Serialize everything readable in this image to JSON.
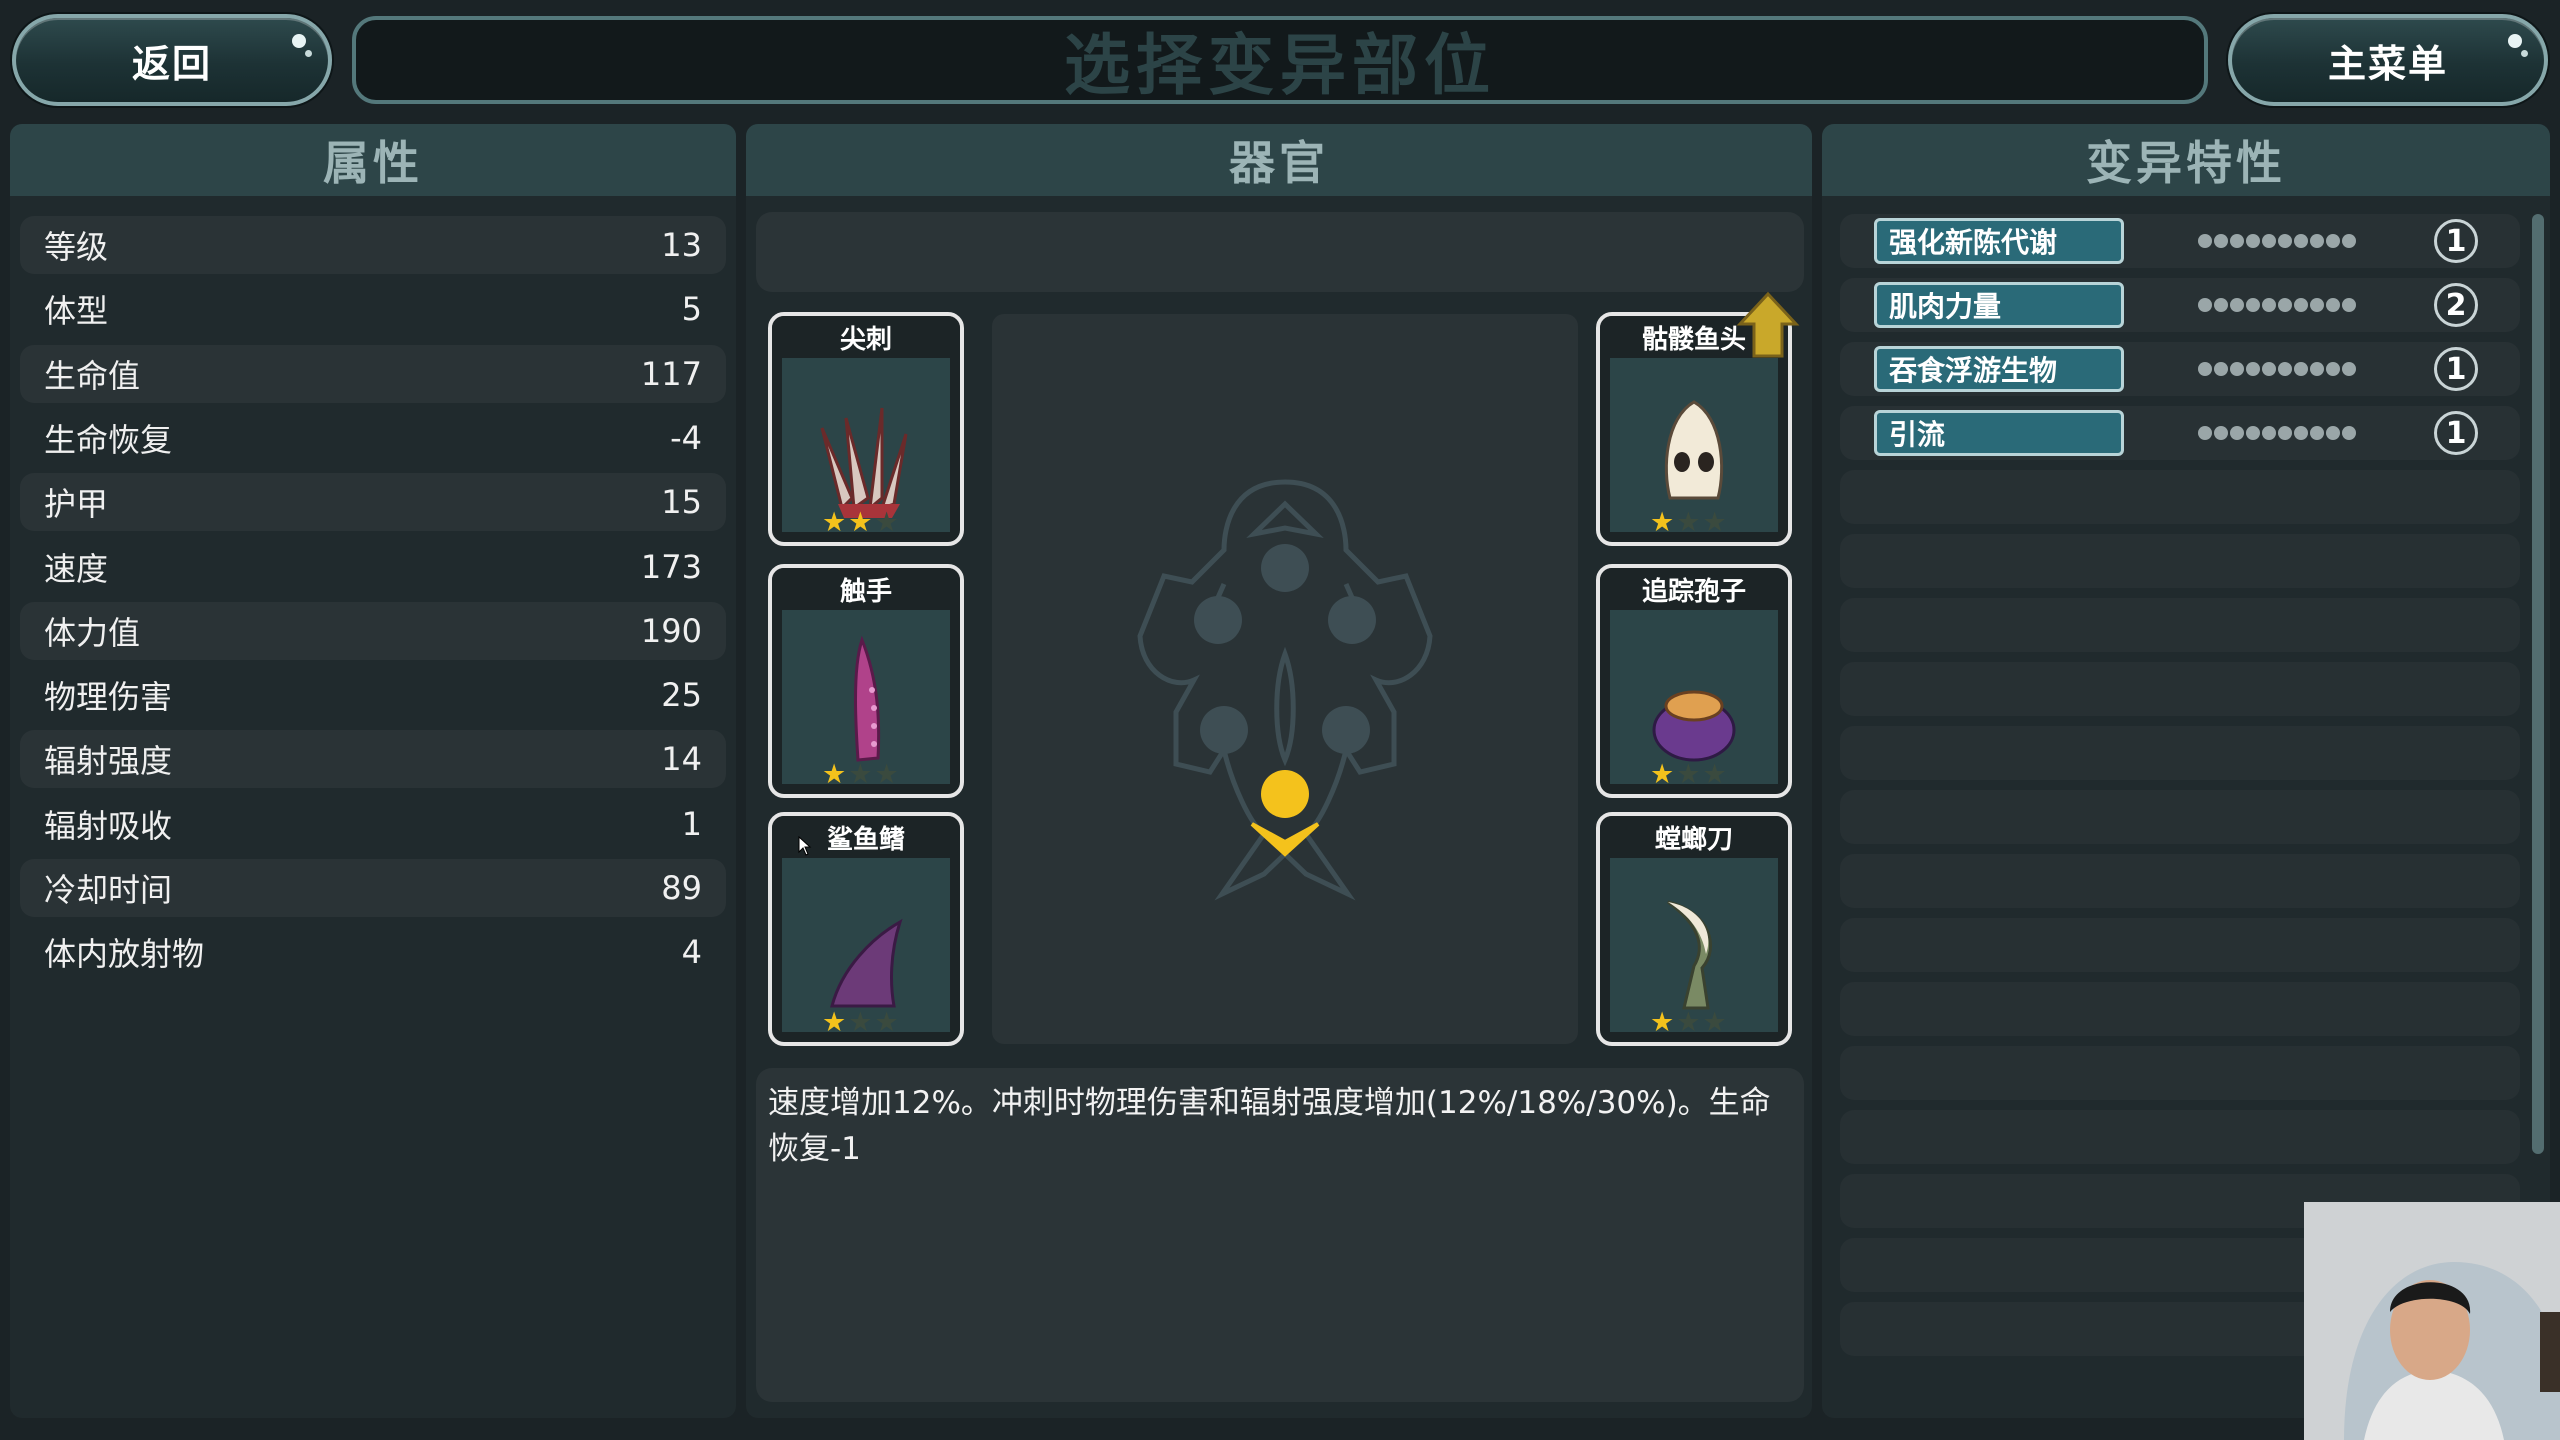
{
  "top": {
    "back_label": "返回",
    "title": "选择变异部位",
    "main_menu_label": "主菜单"
  },
  "attributes": {
    "header": "属性",
    "rows": [
      {
        "label": "等级",
        "value": "13"
      },
      {
        "label": "体型",
        "value": "5"
      },
      {
        "label": "生命值",
        "value": "117"
      },
      {
        "label": "生命恢复",
        "value": "-4"
      },
      {
        "label": "护甲",
        "value": "15"
      },
      {
        "label": "速度",
        "value": "173"
      },
      {
        "label": "体力值",
        "value": "190"
      },
      {
        "label": "物理伤害",
        "value": "25"
      },
      {
        "label": "辐射强度",
        "value": "14"
      },
      {
        "label": "辐射吸收",
        "value": "1"
      },
      {
        "label": "冷却时间",
        "value": "89"
      },
      {
        "label": "体内放射物",
        "value": "4"
      }
    ]
  },
  "organs": {
    "header": "器官",
    "cards": [
      {
        "name": "尖刺",
        "icon": "spike-claws-icon",
        "stars": 2
      },
      {
        "name": "触手",
        "icon": "tentacle-icon",
        "stars": 1
      },
      {
        "name": "鲨鱼鳍",
        "icon": "shark-fin-icon",
        "stars": 1
      },
      {
        "name": "骷髅鱼头",
        "icon": "skull-fish-head-icon",
        "stars": 1
      },
      {
        "name": "追踪孢子",
        "icon": "tracking-spore-icon",
        "stars": 1
      },
      {
        "name": "螳螂刀",
        "icon": "mantis-blade-icon",
        "stars": 1
      }
    ],
    "max_stars": 3,
    "description": "速度增加12%。冲刺时物理伤害和辐射强度增加(12%/18%/30%)。生命恢复-1"
  },
  "traits": {
    "header": "变异特性",
    "items": [
      {
        "name": "强化新陈代谢",
        "count": "1"
      },
      {
        "name": "肌肉力量",
        "count": "2"
      },
      {
        "name": "吞食浮游生物",
        "count": "1"
      },
      {
        "name": "引流",
        "count": "1"
      }
    ]
  },
  "colors": {
    "background": "#1b2326",
    "panel_header": "#2d4548",
    "trait_button": "#2a6a78",
    "star": "#f4c21c",
    "selected_slot": "#f4c21c"
  }
}
